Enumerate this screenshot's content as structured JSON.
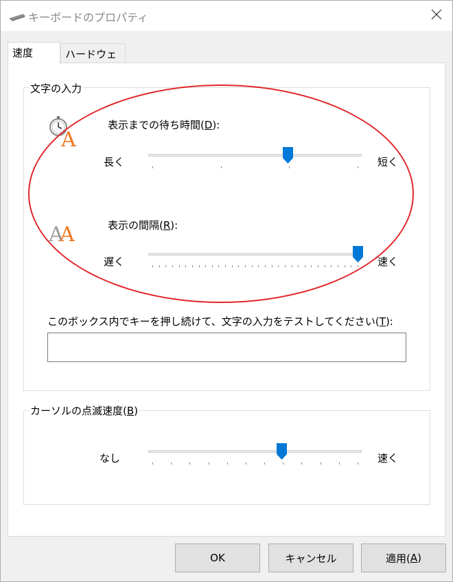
{
  "window": {
    "title": "キーボードのプロパティ"
  },
  "tabs": [
    {
      "label": "速度",
      "active": true
    },
    {
      "label": "ハードウェア",
      "active": false
    }
  ],
  "char_input": {
    "legend": "文字の入力",
    "delay": {
      "label_prefix": "表示までの待ち時間(",
      "mnemonic": "D",
      "label_suffix": "):",
      "min_label": "長く",
      "max_label": "短く",
      "value": 0.66,
      "ticks": 4
    },
    "rate": {
      "label_prefix": "表示の間隔(",
      "mnemonic": "R",
      "label_suffix": "):",
      "min_label": "遅く",
      "max_label": "速く",
      "value": 1.0,
      "ticks": 32
    },
    "test": {
      "label_prefix": "このボックス内でキーを押し続けて、文字の入力をテストしてください(",
      "mnemonic": "T",
      "label_suffix": "):",
      "value": ""
    }
  },
  "cursor_blink": {
    "legend_prefix": "カーソルの点滅速度(",
    "mnemonic": "B",
    "legend_suffix": ")",
    "min_label": "なし",
    "max_label": "速く",
    "value": 0.63,
    "ticks": 12
  },
  "buttons": {
    "ok": "OK",
    "cancel": "キャンセル",
    "apply_prefix": "適用(",
    "apply_mnemonic": "A",
    "apply_suffix": ")"
  },
  "colors": {
    "accent": "#0078d7",
    "annotation": "#e0262a",
    "icon_orange": "#f07820"
  }
}
